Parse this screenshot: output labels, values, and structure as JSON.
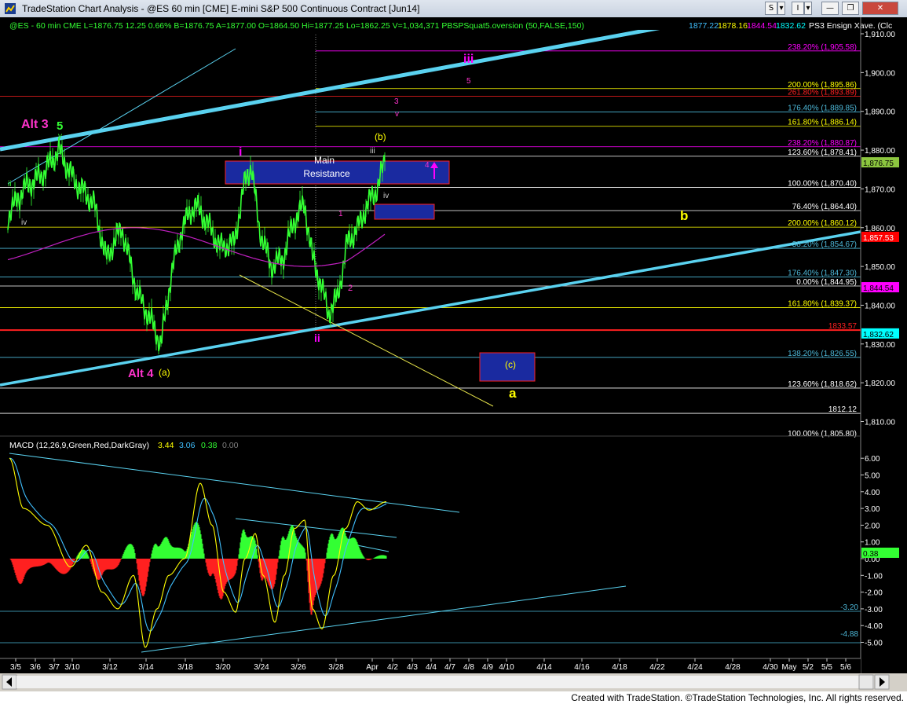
{
  "window": {
    "title": "TradeStation Chart Analysis - @ES 60 min [CME] E-mini S&P 500 Continuous Contract [Jun14]",
    "buttons": [
      "S",
      "▾",
      "I",
      "▾",
      "—",
      "❐",
      "✕"
    ]
  },
  "header": {
    "symbol_line": "@ES - 60 min   CME   L=1876.75   12.25   0.66%   B=1876.75   A=1877.00   O=1864.50   Hi=1877.25   Lo=1862.25   V=1,034,371   PBSPSquat5.oversion (50,FALSE,150)",
    "ind_values": [
      "1877.22",
      "1878.16",
      "1844.54",
      "1832.62"
    ],
    "ind_colors": [
      "#40c0ff",
      "#ffff00",
      "#ff00ff",
      "#00ffff"
    ],
    "ind_label": "PS3 Ensign Xave. (Clc"
  },
  "price_axis": {
    "ticks": [
      "1,910.00",
      "1,900.00",
      "1,890.00",
      "1,880.00",
      "1,870.00",
      "1,860.00",
      "1,850.00",
      "1,840.00",
      "1,830.00",
      "1,820.00",
      "1,810.00"
    ],
    "badges": [
      {
        "text": "1,876.75",
        "bg": "#8cc63f",
        "fg": "#000000"
      },
      {
        "text": "1,857.53",
        "bg": "#ff0000",
        "fg": "#ffffff"
      },
      {
        "text": "1,844.54",
        "bg": "#ff00ff",
        "fg": "#000000"
      },
      {
        "text": "1,832.62",
        "bg": "#00ffff",
        "fg": "#000000"
      }
    ]
  },
  "fib_levels": [
    {
      "text": "238.20% (1,905.58)",
      "color": "#ff00ff"
    },
    {
      "text": "200.00% (1,895.86)",
      "color": "#ffff00"
    },
    {
      "text": "261.80% (1,893.89)",
      "color": "#ff2020"
    },
    {
      "text": "176.40% (1,889.85)",
      "color": "#4db8d8"
    },
    {
      "text": "161.80% (1,886.14)",
      "color": "#ffff00"
    },
    {
      "text": "238.20% (1,880.87)",
      "color": "#ff00ff"
    },
    {
      "text": "123.60% (1,878.41)",
      "color": "#ffffff"
    },
    {
      "text": "100.00% (1,870.40)",
      "color": "#ffffff"
    },
    {
      "text": "76.40% (1,864.40)",
      "color": "#ffffff"
    },
    {
      "text": "200.00% (1,860.12)",
      "color": "#ffff00"
    },
    {
      "text": "38.20% (1,854.67)",
      "color": "#4db8d8"
    },
    {
      "text": "176.40% (1,847.30)",
      "color": "#4db8d8"
    },
    {
      "text": "0.00% (1,844.95)",
      "color": "#ffffff"
    },
    {
      "text": "161.80% (1,839.37)",
      "color": "#ffff00"
    },
    {
      "text": "1833.57",
      "color": "#ff2020"
    },
    {
      "text": "138.20% (1,826.55)",
      "color": "#4db8d8"
    },
    {
      "text": "123.60% (1,818.62)",
      "color": "#ffffff"
    },
    {
      "text": "1812.12",
      "color": "#ffffff"
    },
    {
      "text": "100.00% (1,805.80)",
      "color": "#ffffff"
    }
  ],
  "wave_labels": [
    {
      "text": "Alt 3",
      "color": "#ff33cc"
    },
    {
      "text": "5",
      "color": "#33ff33"
    },
    {
      "text": "v",
      "color": "#33ff33"
    },
    {
      "text": "Alt 4",
      "color": "#ff33cc"
    },
    {
      "text": "(a)",
      "color": "#ffff00"
    },
    {
      "text": "i",
      "color": "#ff00ff"
    },
    {
      "text": "ii",
      "color": "#ff00ff"
    },
    {
      "text": "iii",
      "color": "#ff00ff"
    },
    {
      "text": "iii",
      "color": "#cccccc"
    },
    {
      "text": "iv",
      "color": "#cccccc"
    },
    {
      "text": "(b)",
      "color": "#ffff00"
    },
    {
      "text": "(c)",
      "color": "#ffff00"
    },
    {
      "text": "a",
      "color": "#ffff00"
    },
    {
      "text": "b",
      "color": "#ffff00"
    },
    {
      "text": "1",
      "color": "#ff33cc"
    },
    {
      "text": "2",
      "color": "#ff33cc"
    },
    {
      "text": "3",
      "color": "#ff33cc"
    },
    {
      "text": "4",
      "color": "#ff33cc"
    },
    {
      "text": "5",
      "color": "#ff33cc"
    },
    {
      "text": "v",
      "color": "#ff33cc"
    },
    {
      "text": "iv",
      "color": "#cccccc"
    },
    {
      "text": "ii",
      "color": "#33ff33"
    }
  ],
  "resistance_box": {
    "line1": "Main",
    "line2": "Resistance"
  },
  "macd": {
    "label": "MACD (12,26,9,Green,Red,DarkGray)",
    "values": [
      "3.44",
      "3.06",
      "0.38",
      "0.00"
    ],
    "value_colors": [
      "#ffff00",
      "#40c0ff",
      "#33ff33",
      "#808080"
    ],
    "ticks": [
      "6.00",
      "5.00",
      "4.00",
      "3.00",
      "2.00",
      "1.00",
      "0.00",
      "-1.00",
      "-2.00",
      "-3.00",
      "-4.00",
      "-5.00"
    ],
    "levels": [
      "-3.20",
      "-4.88"
    ],
    "badge": "0.38"
  },
  "date_axis": [
    "3/5",
    "3/6",
    "3/7",
    "3/10",
    "3/12",
    "3/14",
    "3/18",
    "3/20",
    "3/24",
    "3/26",
    "3/28",
    "Apr",
    "4/2",
    "4/3",
    "4/4",
    "4/7",
    "4/8",
    "4/9",
    "4/10",
    "4/14",
    "4/16",
    "4/18",
    "4/22",
    "4/24",
    "4/28",
    "4/30",
    "May",
    "5/2",
    "5/5",
    "5/6"
  ],
  "footer": {
    "credit": "Created with TradeStation. ©TradeStation Technologies, Inc. All rights reserved."
  }
}
